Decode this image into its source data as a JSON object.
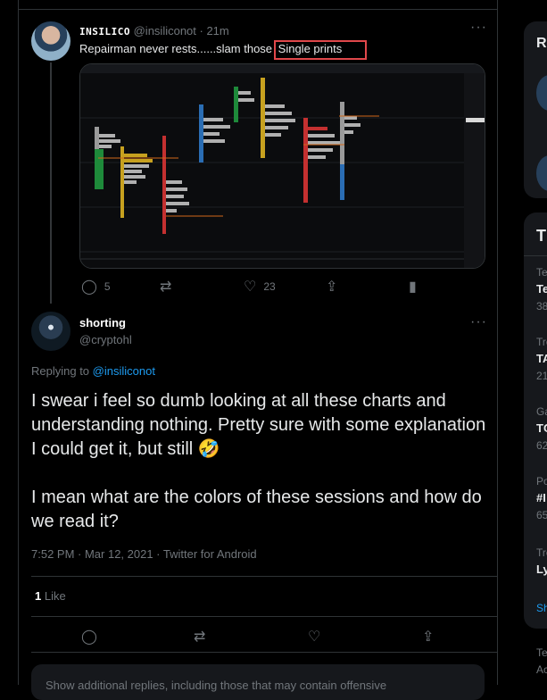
{
  "tweet1": {
    "display_name": "INSILICO",
    "handle": "@insiliconot",
    "time": "· 21m",
    "more": "···",
    "text": "Repairman never rests......slam those",
    "highlighted_text": "Single prints",
    "actions": {
      "reply_count": "5",
      "like_count": "23"
    }
  },
  "reply": {
    "name": "shorting",
    "handle": "@cryptohl",
    "more": "···",
    "replying_prefix": "Replying to ",
    "replying_to": "@insiliconot",
    "text": "I swear i feel so dumb looking at all these charts and understanding nothing. Pretty sure with some explanation I could get it, but still 🤣\n\nI mean what are the colors of these sessions and how do we read it?",
    "timestamp": "7:52 PM · Mar 12, 2021 · Twitter for Android",
    "likes_count": "1",
    "likes_label": "Like"
  },
  "show_more_text": "Show additional replies, including those that may contain offensive",
  "sidebar": {
    "letter_top": "R",
    "letter_box": "T",
    "trends": [
      {
        "a": "Te",
        "b": "Te",
        "c": "38"
      },
      {
        "a": "Tre",
        "b": "TA",
        "c": "21"
      },
      {
        "a": "Ga",
        "b": "TC",
        "c": "62"
      },
      {
        "a": "Po",
        "b": "#I",
        "c": "65"
      },
      {
        "a": "Tre",
        "b": "Ly",
        "c": ""
      }
    ],
    "show": "Sh",
    "footer1": "Te",
    "footer2": "Ac"
  },
  "colors": {
    "accent": "#1d9bf0",
    "highlight_border": "#e0484b",
    "background": "#000000"
  },
  "icons": [
    "reply-icon",
    "retweet-icon",
    "like-icon",
    "share-icon",
    "analytics-icon"
  ]
}
